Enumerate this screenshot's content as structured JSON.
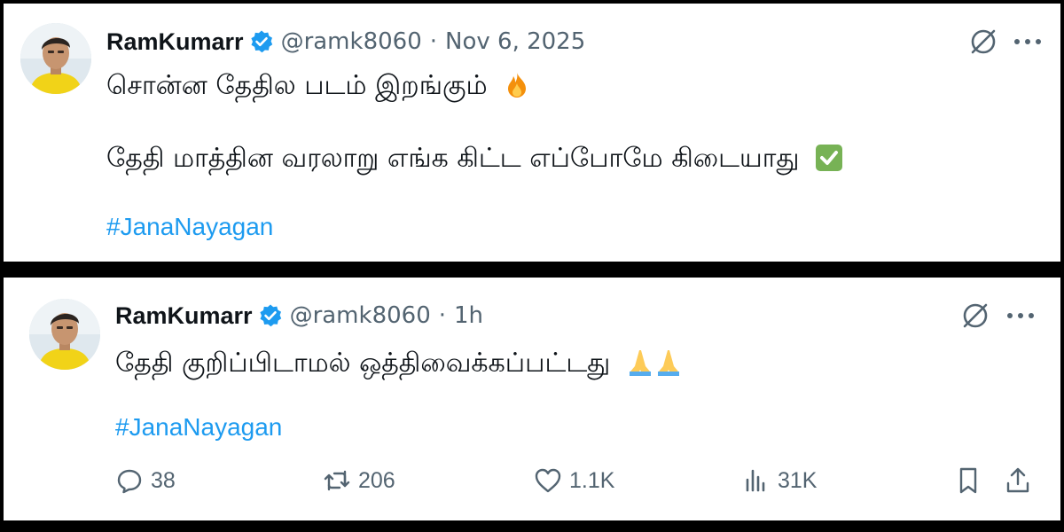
{
  "tweets": [
    {
      "author": {
        "name": "RamKumarr",
        "handle": "@ramk8060",
        "verified": true
      },
      "separator": "·",
      "time": "Nov 6, 2025",
      "lines": [
        "சொன்ன தேதில படம் இறங்கும்",
        "தேதி மாத்தின வரலாறு எங்க கிட்ட எப்போமே கிடையாது"
      ],
      "line_emojis": [
        "fire-emoji",
        "check-mark-emoji"
      ],
      "hashtag": "#JanaNayagan"
    },
    {
      "author": {
        "name": "RamKumarr",
        "handle": "@ramk8060",
        "verified": true
      },
      "separator": "·",
      "time": "1h",
      "lines": [
        "தேதி குறிப்பிடாமல் ஒத்திவைக்கப்பட்டது"
      ],
      "line_emojis": [
        "folded-hands-emoji",
        "folded-hands-emoji"
      ],
      "hashtag": "#JanaNayagan",
      "stats": {
        "replies": "38",
        "reposts": "206",
        "likes": "1.1K",
        "views": "31K"
      }
    }
  ],
  "icons": {
    "header": [
      "grok-icon",
      "more-icon"
    ],
    "actions": [
      "reply-icon",
      "repost-icon",
      "like-icon",
      "views-icon",
      "bookmark-icon",
      "share-icon"
    ]
  },
  "colors": {
    "link": "#1d9bf0",
    "verified_badge": "#1d9bf0",
    "secondary_text": "#536471",
    "primary_text": "#0f1419",
    "divider_background": "#000000"
  }
}
